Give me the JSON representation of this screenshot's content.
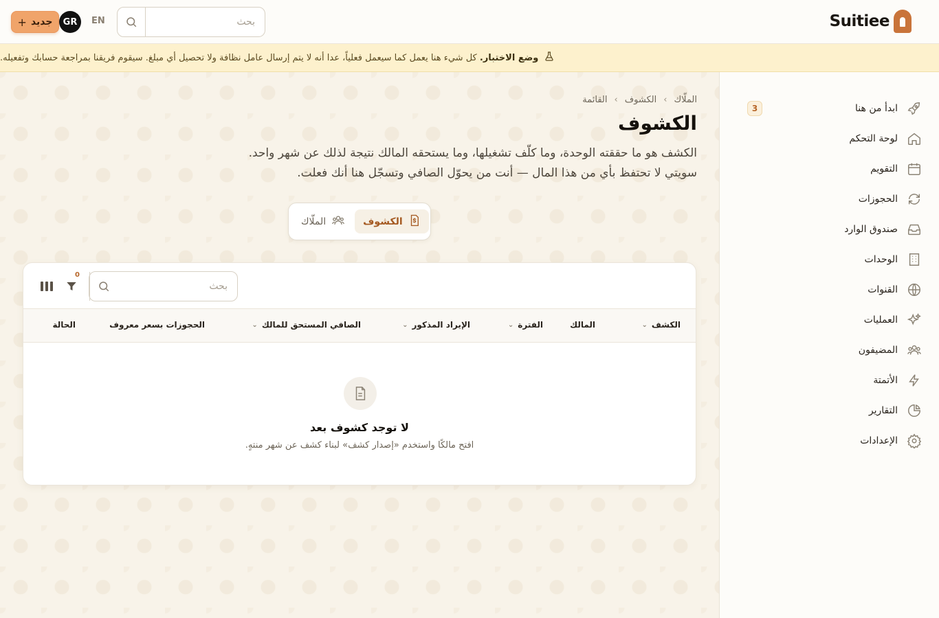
{
  "topbar": {
    "new_button_label": "جديد",
    "new_button_plus": "+",
    "avatar_initials": "GR",
    "language_toggle": "EN",
    "search_placeholder": "بحث",
    "logo_text": "Suitiee"
  },
  "banner": {
    "title": "وضع الاختبار.",
    "message": "كل شيء هنا يعمل كما سيعمل فعلياً، عدا أنه لا يتم إرسال عامل نظافة ولا تحصيل أي مبلغ. سيقوم فريقنا بمراجعة حسابك وتفعيله."
  },
  "sidebar": {
    "items": [
      {
        "label": "ابدأ من هنا",
        "icon": "rocket-icon",
        "badge": "3"
      },
      {
        "label": "لوحة التحكم",
        "icon": "home-icon"
      },
      {
        "label": "التقويم",
        "icon": "calendar-icon"
      },
      {
        "label": "الحجوزات",
        "icon": "refresh-icon"
      },
      {
        "label": "صندوق الوارد",
        "icon": "inbox-icon"
      },
      {
        "label": "الوحدات",
        "icon": "building-icon"
      },
      {
        "label": "القنوات",
        "icon": "globe-icon"
      },
      {
        "label": "العمليات",
        "icon": "sparkles-icon"
      },
      {
        "label": "المضيفون",
        "icon": "users-icon"
      },
      {
        "label": "الأتمتة",
        "icon": "bolt-icon"
      },
      {
        "label": "التقارير",
        "icon": "pie-chart-icon"
      },
      {
        "label": "الإعدادات",
        "icon": "gear-icon"
      }
    ]
  },
  "breadcrumb": {
    "items": [
      "الملّاك",
      "الكشوف",
      "القائمة"
    ]
  },
  "page": {
    "title": "الكشوف",
    "description": "الكشف هو ما حققته الوحدة، وما كلّف تشغيلها، وما يستحقه المالك نتيجة لذلك عن شهر واحد. سويتي لا تحتفظ بأي من هذا المال — أنت من يحوّل الصافي وتسجّل هنا أنك فعلت."
  },
  "segmented": {
    "tabs": [
      {
        "label": "الكشوف",
        "active": true
      },
      {
        "label": "الملّاك",
        "active": false
      }
    ]
  },
  "table": {
    "search_placeholder": "بحث",
    "filter_count": "0",
    "columns": [
      "الكشف",
      "المالك",
      "الفترة",
      "الإيراد المذكور",
      "الصافي المستحق للمالك",
      "الحجوزات بسعر معروف",
      "الحالة"
    ],
    "empty_title": "لا توجد كشوف بعد",
    "empty_subtitle": "افتح مالكًا واستخدم «إصدار كشف» لبناء كشف عن شهر منتهٍ."
  },
  "colors": {
    "accent": "#c9743a",
    "primary_button": "#f0a46a",
    "banner_bg": "#fdf1cd",
    "sidebar_bg": "#fdfcf9",
    "main_bg": "#f8f3e9"
  }
}
